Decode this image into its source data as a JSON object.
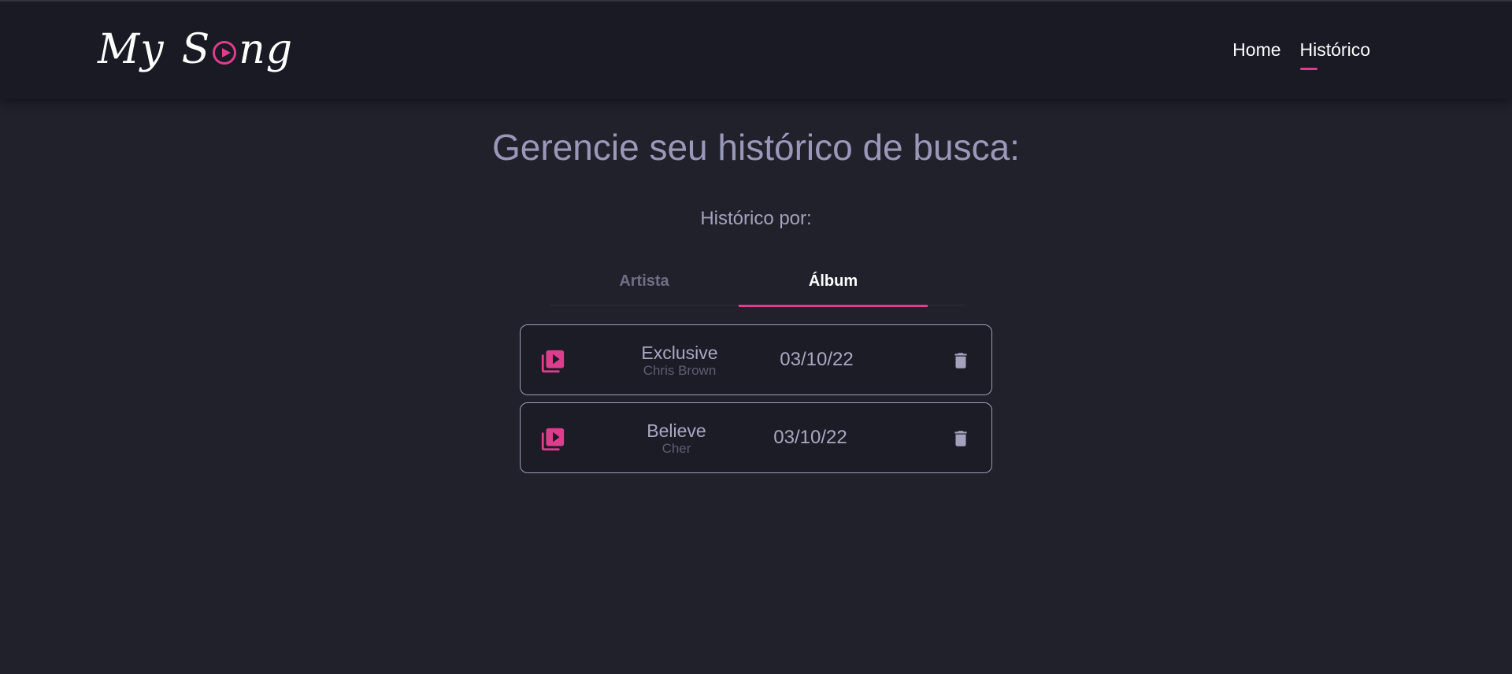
{
  "brand": {
    "logo_text_1": "My",
    "logo_text_2": "S",
    "logo_text_3": "ng",
    "accent_color": "#de3d8d"
  },
  "nav": {
    "home": "Home",
    "history": "Histórico",
    "active": "Histórico"
  },
  "page": {
    "title": "Gerencie seu histórico de busca:",
    "subtitle": "Histórico por:"
  },
  "tabs": {
    "artist": "Artista",
    "album": "Álbum",
    "selected": "Álbum"
  },
  "history": [
    {
      "title": "Exclusive",
      "artist": "Chris Brown",
      "date": "03/10/22",
      "play_icon": "playlist-play-icon",
      "delete_icon": "trash-icon"
    },
    {
      "title": "Believe",
      "artist": "Cher",
      "date": "03/10/22",
      "play_icon": "playlist-play-icon",
      "delete_icon": "trash-icon"
    }
  ]
}
